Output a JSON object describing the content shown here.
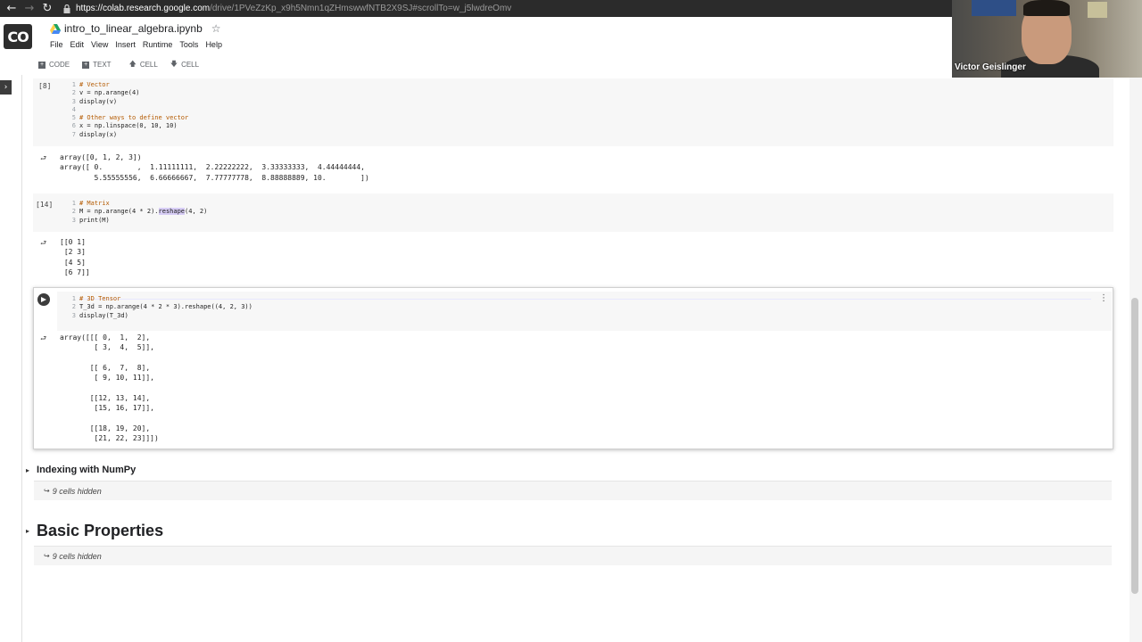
{
  "browser": {
    "back_icon": "arrow-left-icon",
    "forward_icon": "arrow-right-icon",
    "reload_icon": "reload-icon",
    "url_host": "https://colab.research.google.com",
    "url_path": "/drive/1PVeZzKp_x9h5Nmn1qZHmswwfNTB2X9SJ#scrollTo=w_j5lwdreOmv"
  },
  "header": {
    "logo_text": "CO",
    "doc_title": "intro_to_linear_algebra.ipynb",
    "menu": [
      "File",
      "Edit",
      "View",
      "Insert",
      "Runtime",
      "Tools",
      "Help"
    ]
  },
  "toolbar": {
    "code_label": "CODE",
    "text_label": "TEXT",
    "cell_up_label": "CELL",
    "cell_down_label": "CELL"
  },
  "cells": [
    {
      "exec_count": "[8]",
      "lines": [
        {
          "n": "1",
          "text": "# Vector",
          "kind": "comment"
        },
        {
          "n": "2",
          "text": "v = np.arange(4)",
          "kind": "code"
        },
        {
          "n": "3",
          "text": "display(v)",
          "kind": "code"
        },
        {
          "n": "4",
          "text": "",
          "kind": "code"
        },
        {
          "n": "5",
          "text": "# Other ways to define vector",
          "kind": "comment"
        },
        {
          "n": "6",
          "text": "x = np.linspace(0, 10, 10)",
          "kind": "code"
        },
        {
          "n": "7",
          "text": "display(x)",
          "kind": "code"
        }
      ],
      "output": "array([0, 1, 2, 3])\narray([ 0.        ,  1.11111111,  2.22222222,  3.33333333,  4.44444444,\n        5.55555556,  6.66666667,  7.77777778,  8.88888889, 10.        ])"
    },
    {
      "exec_count": "[14]",
      "lines": [
        {
          "n": "1",
          "text": "# Matrix",
          "kind": "comment"
        },
        {
          "n": "2",
          "pre": "M = np.arange(4 * 2).",
          "sel": "reshape",
          "post": "(4, 2)",
          "kind": "code"
        },
        {
          "n": "3",
          "text": "print(M)",
          "kind": "code"
        }
      ],
      "output": "[[0 1]\n [2 3]\n [4 5]\n [6 7]]"
    },
    {
      "exec_count": "",
      "lines": [
        {
          "n": "1",
          "text": "# 3D Tensor",
          "kind": "comment"
        },
        {
          "n": "2",
          "text": "T_3d = np.arange(4 * 2 * 3).reshape((4, 2, 3))",
          "kind": "code"
        },
        {
          "n": "3",
          "text": "display(T_3d)",
          "kind": "code"
        }
      ],
      "output": "array([[[ 0,  1,  2],\n        [ 3,  4,  5]],\n\n       [[ 6,  7,  8],\n        [ 9, 10, 11]],\n\n       [[12, 13, 14],\n        [15, 16, 17]],\n\n       [[18, 19, 20],\n        [21, 22, 23]]])"
    }
  ],
  "sections": [
    {
      "title": "Indexing with NumPy",
      "hidden": "9 cells hidden"
    },
    {
      "title": "Basic Properties",
      "hidden": "9 cells hidden"
    }
  ],
  "webcam": {
    "name": "Victor Geislinger"
  }
}
